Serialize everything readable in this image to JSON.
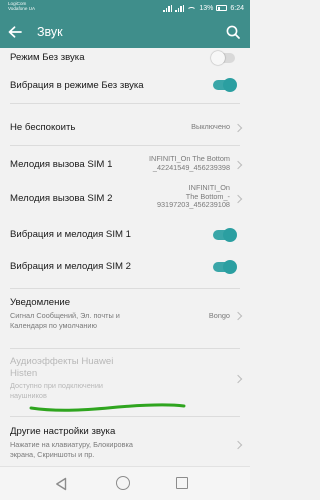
{
  "status_bar": {
    "carrier_line1": "LogiCom",
    "carrier_line2": "Vodafone UA",
    "battery": "13%",
    "time": "6:24"
  },
  "toolbar": {
    "title": "Звук",
    "back_icon": "arrow-left-icon",
    "search_icon": "search-icon"
  },
  "settings": {
    "silent_mode": {
      "label": "Режим Без звука",
      "toggle": "off"
    },
    "vibrate_silent": {
      "label": "Вибрация в режиме Без звука",
      "toggle": "on"
    },
    "do_not_disturb": {
      "label": "Не беспокоить",
      "value": "Выключено"
    },
    "ringtone_sim1": {
      "label": "Мелодия вызова SIM 1",
      "value_line1": "INFINITI_On The Bottom",
      "value_line2": "_42241549_456239398"
    },
    "ringtone_sim2": {
      "label": "Мелодия вызова SIM 2",
      "value_line1": "INFINITI_On",
      "value_line2": "The Bottom_-",
      "value_line3": "93197203_456239108"
    },
    "vibrate_ringtone_sim1": {
      "label": "Вибрация и мелодия SIM 1",
      "toggle": "on"
    },
    "vibrate_ringtone_sim2": {
      "label": "Вибрация и мелодия SIM 2",
      "toggle": "on"
    },
    "notification": {
      "label": "Уведомление",
      "sub_line1": "Сигнал Сообщений, Эл. почты и",
      "sub_line2": "Календаря по умолчанию",
      "value": "Bongo"
    },
    "histen": {
      "label_line1": "Аудиоэффекты Huawei",
      "label_line2": "Histen",
      "sub_line1": "Доступно при подключении",
      "sub_line2": "наушников",
      "enabled": false
    },
    "other_sounds": {
      "label": "Другие настройки звука",
      "sub_line1": "Нажатие на клавиатуру, Блокировка",
      "sub_line2": "экрана, Скриншоты и пр."
    }
  },
  "colors": {
    "primary": "#3f8e8b",
    "accent": "#3aa6a8",
    "annotation": "#2fa51f"
  }
}
